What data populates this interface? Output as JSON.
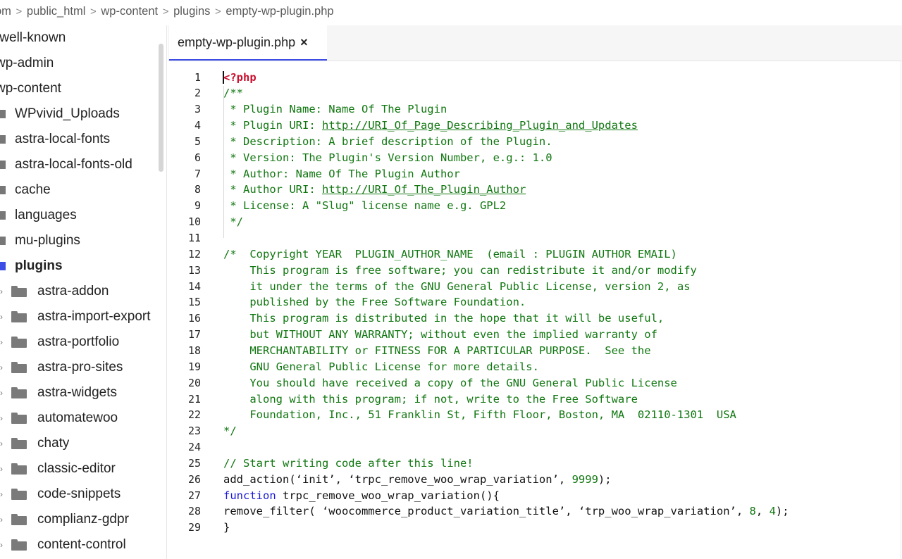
{
  "breadcrumb": {
    "items": [
      "om",
      "public_html",
      "wp-content",
      "plugins",
      "empty-wp-plugin.php"
    ],
    "separator": ">"
  },
  "sidebar": {
    "items": [
      {
        "label": ".well-known",
        "level": 0
      },
      {
        "label": "wp-admin",
        "level": 0
      },
      {
        "label": "wp-content",
        "level": 0
      },
      {
        "label": "WPvivid_Uploads",
        "level": 1
      },
      {
        "label": "astra-local-fonts",
        "level": 1
      },
      {
        "label": "astra-local-fonts-old",
        "level": 1
      },
      {
        "label": "cache",
        "level": 1
      },
      {
        "label": "languages",
        "level": 1
      },
      {
        "label": "mu-plugins",
        "level": 1
      },
      {
        "label": "plugins",
        "level": 1,
        "active": true
      },
      {
        "label": "astra-addon",
        "level": 2
      },
      {
        "label": "astra-import-export",
        "level": 2
      },
      {
        "label": "astra-portfolio",
        "level": 2
      },
      {
        "label": "astra-pro-sites",
        "level": 2
      },
      {
        "label": "astra-widgets",
        "level": 2
      },
      {
        "label": "automatewoo",
        "level": 2
      },
      {
        "label": "chaty",
        "level": 2
      },
      {
        "label": "classic-editor",
        "level": 2
      },
      {
        "label": "code-snippets",
        "level": 2
      },
      {
        "label": "complianz-gdpr",
        "level": 2
      },
      {
        "label": "content-control",
        "level": 2
      }
    ]
  },
  "editor": {
    "tab": {
      "label": "empty-wp-plugin.php",
      "close": "×"
    },
    "lines": [
      {
        "n": "1",
        "tokens": [
          {
            "t": "<?php",
            "c": "tag"
          }
        ]
      },
      {
        "n": "2",
        "tokens": [
          {
            "t": "/**",
            "c": "comment"
          }
        ]
      },
      {
        "n": "3",
        "tokens": [
          {
            "t": " * Plugin Name: Name Of The Plugin",
            "c": "comment"
          }
        ]
      },
      {
        "n": "4",
        "tokens": [
          {
            "t": " * Plugin URI: ",
            "c": "comment"
          },
          {
            "t": "http://URI_Of_Page_Describing_Plugin_and_Updates",
            "c": "comment-u"
          }
        ]
      },
      {
        "n": "5",
        "tokens": [
          {
            "t": " * Description: A brief description of the Plugin.",
            "c": "comment"
          }
        ]
      },
      {
        "n": "6",
        "tokens": [
          {
            "t": " * Version: The Plugin's Version Number, e.g.: 1.0",
            "c": "comment"
          }
        ]
      },
      {
        "n": "7",
        "tokens": [
          {
            "t": " * Author: Name Of The Plugin Author",
            "c": "comment"
          }
        ]
      },
      {
        "n": "8",
        "tokens": [
          {
            "t": " * Author URI: ",
            "c": "comment"
          },
          {
            "t": "http://URI_Of_The_Plugin_Author",
            "c": "comment-u"
          }
        ]
      },
      {
        "n": "9",
        "tokens": [
          {
            "t": " * License: A \"Slug\" license name e.g. GPL2",
            "c": "comment"
          }
        ]
      },
      {
        "n": "10",
        "tokens": [
          {
            "t": " */",
            "c": "comment"
          }
        ]
      },
      {
        "n": "11",
        "tokens": []
      },
      {
        "n": "12",
        "tokens": [
          {
            "t": "/*  Copyright YEAR  PLUGIN_AUTHOR_NAME  (email : PLUGIN AUTHOR EMAIL)",
            "c": "comment"
          }
        ]
      },
      {
        "n": "13",
        "tokens": [
          {
            "t": "    This program is free software; you can redistribute it and/or modify",
            "c": "comment"
          }
        ]
      },
      {
        "n": "14",
        "tokens": [
          {
            "t": "    it under the terms of the GNU General Public License, version 2, as",
            "c": "comment"
          }
        ]
      },
      {
        "n": "15",
        "tokens": [
          {
            "t": "    published by the Free Software Foundation.",
            "c": "comment"
          }
        ]
      },
      {
        "n": "16",
        "tokens": [
          {
            "t": "    This program is distributed in the hope that it will be useful,",
            "c": "comment"
          }
        ]
      },
      {
        "n": "17",
        "tokens": [
          {
            "t": "    but WITHOUT ANY WARRANTY; without even the implied warranty of",
            "c": "comment"
          }
        ]
      },
      {
        "n": "18",
        "tokens": [
          {
            "t": "    MERCHANTABILITY or FITNESS FOR A PARTICULAR PURPOSE.  See the",
            "c": "comment"
          }
        ]
      },
      {
        "n": "19",
        "tokens": [
          {
            "t": "    GNU General Public License for more details.",
            "c": "comment"
          }
        ]
      },
      {
        "n": "20",
        "tokens": [
          {
            "t": "    You should have received a copy of the GNU General Public License",
            "c": "comment"
          }
        ]
      },
      {
        "n": "21",
        "tokens": [
          {
            "t": "    along with this program; if not, write to the Free Software",
            "c": "comment"
          }
        ]
      },
      {
        "n": "22",
        "tokens": [
          {
            "t": "    Foundation, Inc., 51 Franklin St, Fifth Floor, Boston, MA  02110-1301  USA",
            "c": "comment"
          }
        ]
      },
      {
        "n": "23",
        "tokens": [
          {
            "t": "*/",
            "c": "comment"
          }
        ]
      },
      {
        "n": "24",
        "tokens": []
      },
      {
        "n": "25",
        "tokens": [
          {
            "t": "// Start writing code after this line!",
            "c": "comment"
          }
        ]
      },
      {
        "n": "26",
        "tokens": [
          {
            "t": "add_action(‘init’, ‘trpc_remove_woo_wrap_variation’, ",
            "c": "plain"
          },
          {
            "t": "9999",
            "c": "num"
          },
          {
            "t": ");",
            "c": "plain"
          }
        ]
      },
      {
        "n": "27",
        "tokens": [
          {
            "t": "function",
            "c": "kw"
          },
          {
            "t": " trpc_remove_woo_wrap_variation(){",
            "c": "plain"
          }
        ]
      },
      {
        "n": "28",
        "tokens": [
          {
            "t": "remove_filter( ‘woocommerce_product_variation_title’, ‘trp_woo_wrap_variation’, ",
            "c": "plain"
          },
          {
            "t": "8",
            "c": "num"
          },
          {
            "t": ", ",
            "c": "plain"
          },
          {
            "t": "4",
            "c": "num"
          },
          {
            "t": ");",
            "c": "plain"
          }
        ]
      },
      {
        "n": "29",
        "tokens": [
          {
            "t": "}",
            "c": "plain"
          }
        ]
      }
    ]
  },
  "colors": {
    "accent": "#3d4ee6",
    "comment": "#117711",
    "php_tag": "#c8102e",
    "keyword": "#1a1ad6"
  }
}
